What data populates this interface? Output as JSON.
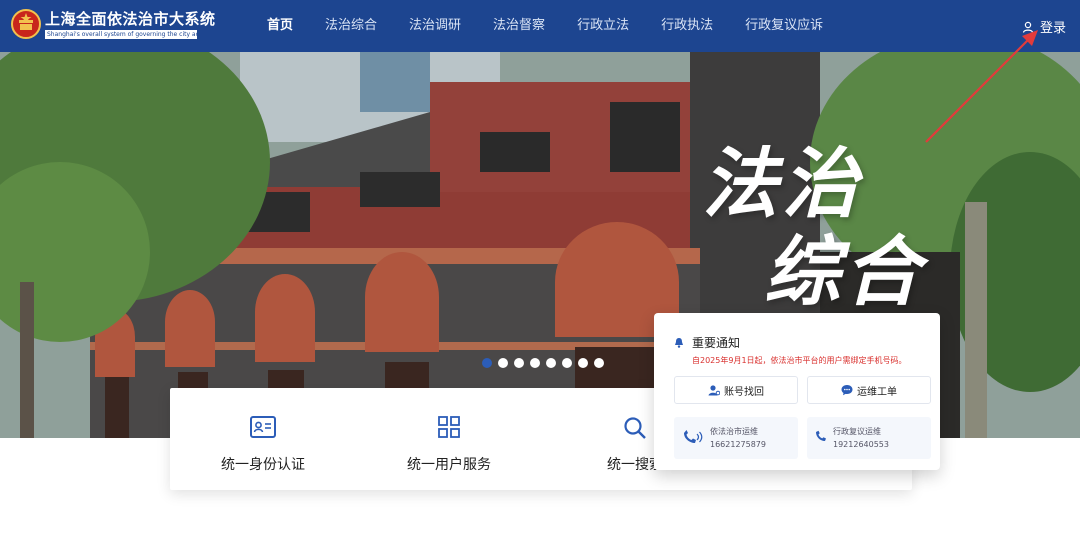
{
  "header": {
    "title": "上海全面依法治市大系统",
    "subtitle": "Shanghai's overall system of governing the city according to law",
    "nav": [
      {
        "label": "首页",
        "active": true
      },
      {
        "label": "法治综合",
        "active": false
      },
      {
        "label": "法治调研",
        "active": false
      },
      {
        "label": "法治督察",
        "active": false
      },
      {
        "label": "行政立法",
        "active": false
      },
      {
        "label": "行政执法",
        "active": false
      },
      {
        "label": "行政复议应诉",
        "active": false
      }
    ],
    "login_label": "登录"
  },
  "hero": {
    "title_line1": "法治",
    "title_line2": "综合",
    "slides_total": 8,
    "active_slide": 1
  },
  "services": [
    {
      "label": "统一身份认证",
      "icon": "id-card-icon"
    },
    {
      "label": "统一用户服务",
      "icon": "grid-apps-icon"
    },
    {
      "label": "统一搜索",
      "icon": "search-icon"
    }
  ],
  "notice": {
    "title": "重要通知",
    "text": "自2025年9月1日起，依法治市平台的用户需绑定手机号码。",
    "buttons": [
      {
        "label": "账号找回",
        "icon": "user-recover-icon"
      },
      {
        "label": "运维工单",
        "icon": "chat-bubble-icon"
      }
    ],
    "contacts": [
      {
        "name": "依法治市运维",
        "phone": "16621275879",
        "icon": "phone-wave-icon"
      },
      {
        "name": "行政复议运维",
        "phone": "19212640553",
        "icon": "phone-icon"
      }
    ]
  },
  "colors": {
    "header_bg": "#1d4590",
    "accent": "#2c5db8",
    "notice_red": "#d9302e",
    "arrow": "#e23b3b"
  }
}
